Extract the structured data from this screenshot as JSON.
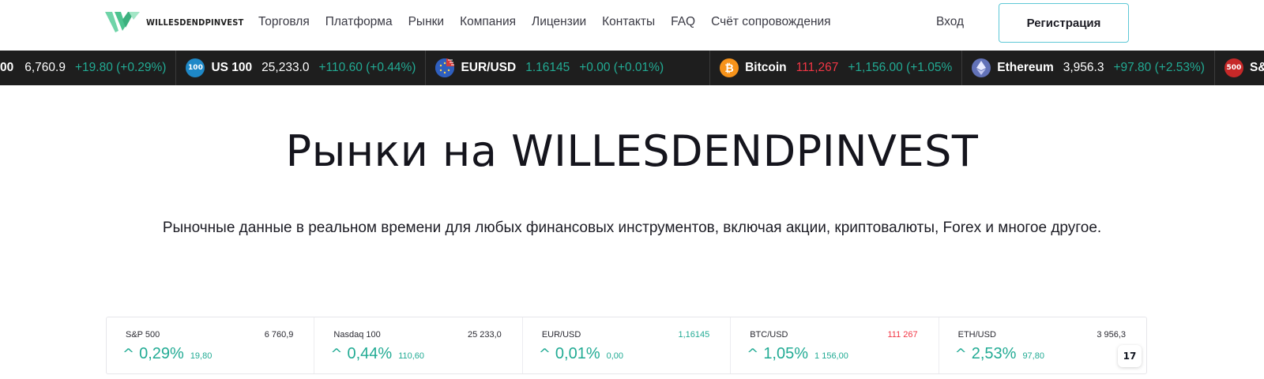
{
  "header": {
    "logo_text": "WILLESDENDPINVEST",
    "nav": [
      "Торговля",
      "Платформа",
      "Рынки",
      "Компания",
      "Лицензии",
      "Контакты",
      "FAQ",
      "Счёт сопровождения"
    ],
    "login_label": "Вход",
    "register_label": "Регистрация",
    "accent_color": "#5ec8d6"
  },
  "ticker": {
    "items": [
      {
        "icon": "",
        "icon_color": "",
        "name": "",
        "price": "6,760.9",
        "price_color": "white",
        "change": "+19.80 (+0.29%)",
        "lead": "00"
      },
      {
        "icon": "100",
        "icon_color": "#1e88c7",
        "name": "US 100",
        "price": "25,233.0",
        "price_color": "white",
        "change": "+110.60 (+0.44%)"
      },
      {
        "icon": "eu-us-flag-icon",
        "icon_color": "#2f5fbf",
        "name": "EUR/USD",
        "price": "1.16145",
        "price_color": "green",
        "change": "+0.00 (+0.01%)"
      },
      {
        "icon": "bitcoin-icon",
        "icon_color": "#f7931a",
        "name": "Bitcoin",
        "price": "111,267",
        "price_color": "red",
        "change": "+1,156.00 (+1.05%"
      },
      {
        "icon": "ethereum-icon",
        "icon_color": "#6272b8",
        "name": "Ethereum",
        "price": "3,956.3",
        "price_color": "white",
        "change": "+97.80 (+2.53%)"
      },
      {
        "icon": "500",
        "icon_color": "#c62828",
        "name": "S&",
        "price": "",
        "price_color": "white",
        "change": ""
      }
    ]
  },
  "hero": {
    "title": "Рынки на WILLESDENDPINVEST",
    "subtitle": "Рыночные данные в реальном времени для любых финансовых инструментов, включая акции, криптовалюты, Forex и многое другое."
  },
  "widget": {
    "cells": [
      {
        "name": "S&P 500",
        "price": "6 760,9",
        "price_color": "default",
        "pct": "0,29%",
        "abs": "19,80"
      },
      {
        "name": "Nasdaq 100",
        "price": "25 233,0",
        "price_color": "default",
        "pct": "0,44%",
        "abs": "110,60"
      },
      {
        "name": "EUR/USD",
        "price": "1,16145",
        "price_color": "green",
        "pct": "0,01%",
        "abs": "0,00"
      },
      {
        "name": "BTC/USD",
        "price": "111 267",
        "price_color": "red",
        "pct": "1,05%",
        "abs": "1 156,00"
      },
      {
        "name": "ETH/USD",
        "price": "3 956,3",
        "price_color": "default",
        "pct": "2,53%",
        "abs": "97,80"
      }
    ],
    "tv_badge": "17",
    "arrow": "^"
  }
}
